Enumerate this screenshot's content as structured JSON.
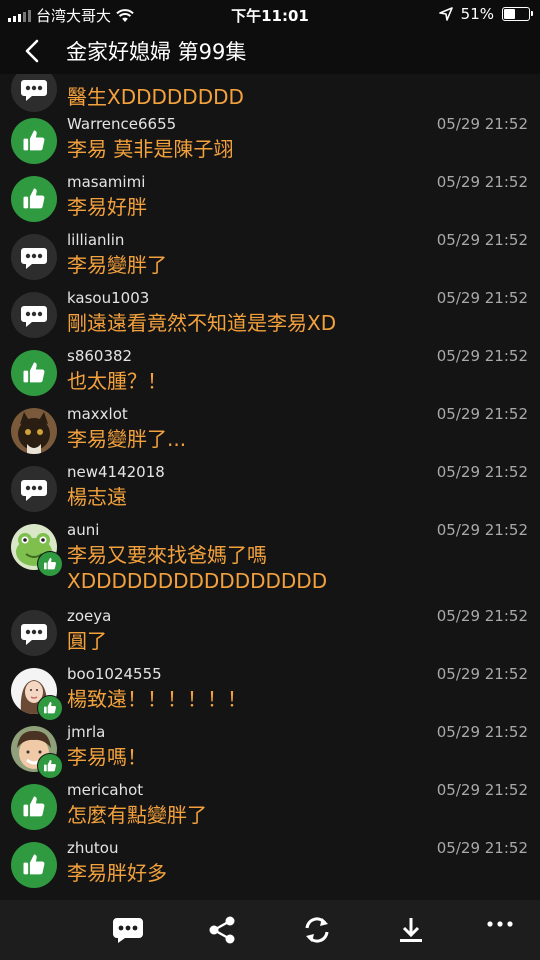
{
  "status_bar": {
    "carrier": "台湾大哥大",
    "time": "下午11:01",
    "battery": "51%",
    "battery_level": 0.51
  },
  "header": {
    "title": "金家好媳婦 第99集"
  },
  "comments": [
    {
      "user": "",
      "time": "",
      "text": "醫生XDDDDDDDD",
      "avatar": "comment"
    },
    {
      "user": "Warrence6655",
      "time": "05/29 21:52",
      "text": "李易 莫非是陳子翊",
      "avatar": "like"
    },
    {
      "user": "masamimi",
      "time": "05/29 21:52",
      "text": "李易好胖",
      "avatar": "like"
    },
    {
      "user": "lillianlin",
      "time": "05/29 21:52",
      "text": "李易變胖了",
      "avatar": "comment"
    },
    {
      "user": "kasou1003",
      "time": "05/29 21:52",
      "text": "剛遠遠看竟然不知道是李易XD",
      "avatar": "comment"
    },
    {
      "user": "s860382",
      "time": "05/29 21:52",
      "text": "也太腫？！",
      "avatar": "like"
    },
    {
      "user": "maxxlot",
      "time": "05/29 21:52",
      "text": "李易變胖了...",
      "avatar": "cat-photo"
    },
    {
      "user": "new4142018",
      "time": "05/29 21:52",
      "text": "楊志遠",
      "avatar": "comment"
    },
    {
      "user": "auni",
      "time": "05/29 21:52",
      "text": "李易又要來找爸媽了嗎\nXDDDDDDDDDDDDDDDD",
      "avatar": "frog-photo"
    },
    {
      "user": "zoeya",
      "time": "05/29 21:52",
      "text": "圓了",
      "avatar": "comment"
    },
    {
      "user": "boo1024555",
      "time": "05/29 21:52",
      "text": "楊致遠！！！！！！",
      "avatar": "girl-photo"
    },
    {
      "user": "jmrla",
      "time": "05/29 21:52",
      "text": "李易嗎！",
      "avatar": "face-photo"
    },
    {
      "user": "mericahot",
      "time": "05/29 21:52",
      "text": "怎麼有點變胖了",
      "avatar": "like"
    },
    {
      "user": "zhutou",
      "time": "05/29 21:52",
      "text": "李易胖好多",
      "avatar": "like"
    }
  ],
  "toolbar": {
    "icons": [
      "comment-icon",
      "share-icon",
      "refresh-icon",
      "download-icon",
      "more-icon"
    ]
  },
  "colors": {
    "message_text": "#f2a13d",
    "like_green": "#2f9a3f",
    "background": "#141414",
    "toolbar": "#1d1d1d"
  }
}
